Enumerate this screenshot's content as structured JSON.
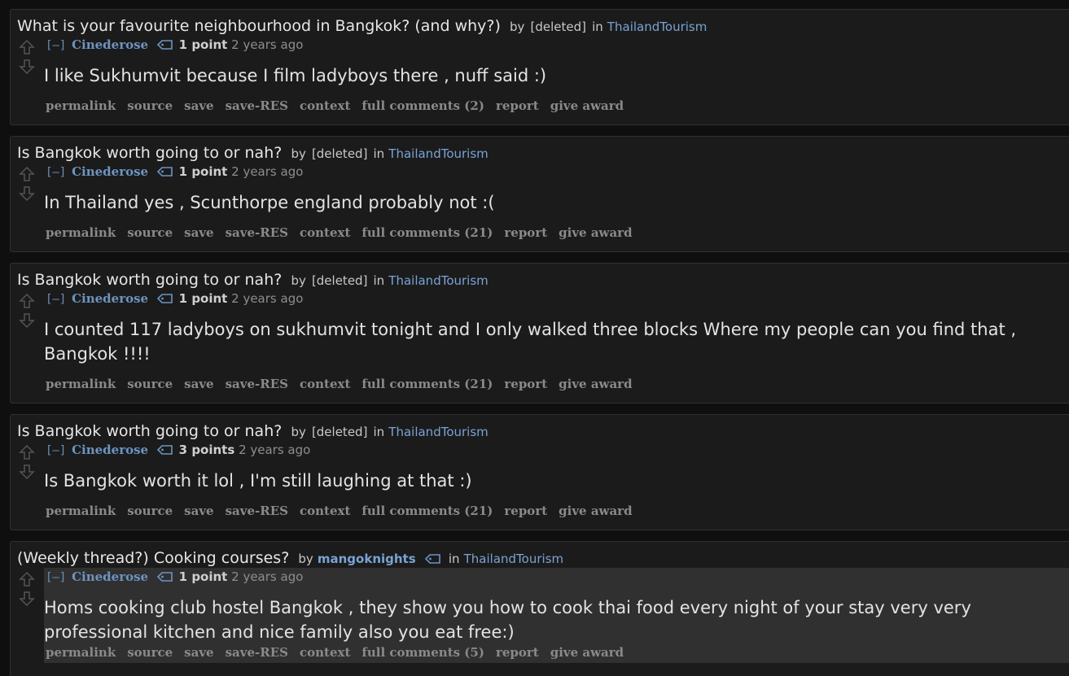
{
  "entries": [
    {
      "thread_title": "What is your favourite neighbourhood in Bangkok? (and why?)",
      "by_label": "by",
      "op": "[deleted]",
      "in_label": "in",
      "subreddit": "ThailandTourism",
      "collapse": "[–]",
      "author": "Cinederose",
      "score": "1 point",
      "time": "2 years ago",
      "body": "I like Sukhumvit because I film ladyboys there , nuff said :)",
      "buttons": [
        "permalink",
        "source",
        "save",
        "save-RES",
        "context",
        "full comments (2)",
        "report",
        "give award"
      ]
    },
    {
      "thread_title": "Is Bangkok worth going to or nah?",
      "by_label": "by",
      "op": "[deleted]",
      "in_label": "in",
      "subreddit": "ThailandTourism",
      "collapse": "[–]",
      "author": "Cinederose",
      "score": "1 point",
      "time": "2 years ago",
      "body": "In Thailand yes , Scunthorpe england probably not :(",
      "buttons": [
        "permalink",
        "source",
        "save",
        "save-RES",
        "context",
        "full comments (21)",
        "report",
        "give award"
      ]
    },
    {
      "thread_title": "Is Bangkok worth going to or nah?",
      "by_label": "by",
      "op": "[deleted]",
      "in_label": "in",
      "subreddit": "ThailandTourism",
      "collapse": "[–]",
      "author": "Cinederose",
      "score": "1 point",
      "time": "2 years ago",
      "body": "I counted 117 ladyboys on sukhumvit tonight and I only walked three blocks Where my people can you find that , Bangkok !!!!",
      "buttons": [
        "permalink",
        "source",
        "save",
        "save-RES",
        "context",
        "full comments (21)",
        "report",
        "give award"
      ]
    },
    {
      "thread_title": "Is Bangkok worth going to or nah?",
      "by_label": "by",
      "op": "[deleted]",
      "in_label": "in",
      "subreddit": "ThailandTourism",
      "collapse": "[–]",
      "author": "Cinederose",
      "score": "3 points",
      "time": "2 years ago",
      "body": "Is Bangkok worth it lol , I'm still laughing at that :)",
      "buttons": [
        "permalink",
        "source",
        "save",
        "save-RES",
        "context",
        "full comments (21)",
        "report",
        "give award"
      ]
    },
    {
      "thread_title": "(Weekly thread?) Cooking courses?",
      "by_label": "by",
      "op": "mangoknights",
      "in_label": "in",
      "subreddit": "ThailandTourism",
      "collapse": "[–]",
      "author": "Cinederose",
      "score": "1 point",
      "time": "2 years ago",
      "body": "Homs cooking club hostel Bangkok , they show you how to cook thai food every night of your stay very very professional kitchen and nice family also you eat free:)",
      "buttons": [
        "permalink",
        "source",
        "save",
        "save-RES",
        "context",
        "full comments (5)",
        "report",
        "give award"
      ]
    }
  ],
  "colors": {
    "background": "#0f0f0f",
    "entry_bg": "#1b1b1b",
    "link": "#79a3d4",
    "highlight_bg": "#303030"
  },
  "icons": [
    "upvote-arrow-icon",
    "downvote-arrow-icon",
    "tag-icon"
  ]
}
